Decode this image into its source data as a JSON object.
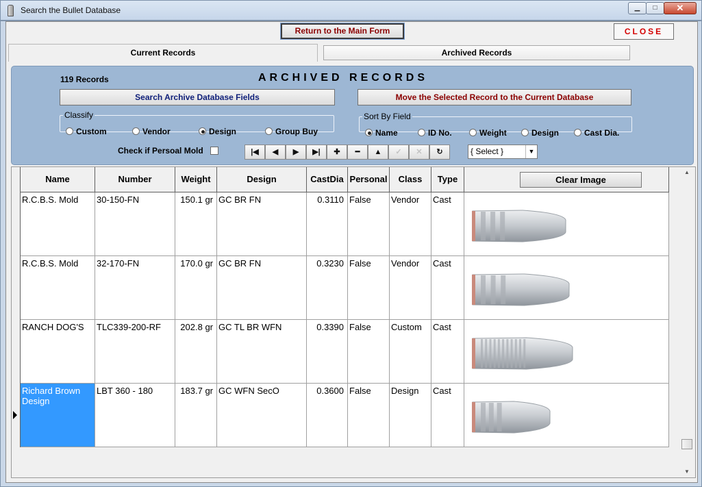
{
  "window": {
    "title": "Search the Bullet Database",
    "min_glyph": "▁",
    "max_glyph": "□",
    "close_glyph": "✕"
  },
  "toolbar": {
    "main_form_label": "Return to the Main Form",
    "close_label": "CLOSE"
  },
  "tabs": [
    {
      "label": "Current Records",
      "active": false
    },
    {
      "label": "Archived Records",
      "active": true
    }
  ],
  "panel": {
    "record_count": "119 Records",
    "heading": "ARCHIVED RECORDS",
    "search_button": "Search Archive Database Fields",
    "move_button": "Move the Selected Record to the Current Database",
    "classify": {
      "legend": "Classify",
      "options": [
        "Custom",
        "Vendor",
        "Design",
        "Group Buy"
      ],
      "selected": "Design"
    },
    "sort": {
      "legend": "Sort By Field",
      "options": [
        "Name",
        "ID No.",
        "Weight",
        "Design",
        "Cast Dia."
      ],
      "selected": "Name"
    },
    "personal_check_label": "Check if Persoal Mold",
    "personal_checked": false,
    "nav": {
      "first": "|◀",
      "prev": "◀",
      "next": "▶",
      "last": "▶|",
      "add": "✚",
      "remove": "━",
      "up": "▲",
      "save": "✓",
      "cancel": "✕",
      "refresh": "↻"
    },
    "select_value": "{ Select }",
    "select_arrow": "▼"
  },
  "grid": {
    "columns": [
      "Name",
      "Number",
      "Weight",
      "Design",
      "CastDia",
      "Personal",
      "Class",
      "Type"
    ],
    "clear_image_label": "Clear Image",
    "current_row_marker": "▶",
    "rows": [
      {
        "name": "R.C.B.S. Mold",
        "number": "30-150-FN",
        "weight": "150.1 gr",
        "design": "GC BR FN",
        "castdia": "0.3110",
        "personal": "False",
        "class": "Vendor",
        "type": "Cast",
        "bullet_image": "flat-nose-bullet"
      },
      {
        "name": "R.C.B.S. Mold",
        "number": "32-170-FN",
        "weight": "170.0 gr",
        "design": "GC BR FN",
        "castdia": "0.3230",
        "personal": "False",
        "class": "Vendor",
        "type": "Cast",
        "bullet_image": "flat-nose-bullet"
      },
      {
        "name": "RANCH DOG'S",
        "number": "TLC339-200-RF",
        "weight": "202.8 gr",
        "design": "GC TL BR WFN",
        "castdia": "0.3390",
        "personal": "False",
        "class": "Custom",
        "type": "Cast",
        "bullet_image": "tumble-lube-bullet"
      },
      {
        "name": "Richard Brown Design",
        "number": "LBT 360 - 180",
        "weight": "183.7 gr",
        "design": "GC WFN SecO",
        "castdia": "0.3600",
        "personal": "False",
        "class": "Design",
        "type": "Cast",
        "bullet_image": "wide-flat-nose-bullet",
        "selected": true
      }
    ]
  },
  "scrollbar": {
    "up": "▲",
    "down": "▼"
  },
  "colors": {
    "panel_bg": "#9db7d4",
    "selected_cell": "#3399ff",
    "accent_red": "#8b0000",
    "accent_blue": "#10207a",
    "bullet_body": "#c8ccd1",
    "gas_check": "#c98a7c"
  }
}
